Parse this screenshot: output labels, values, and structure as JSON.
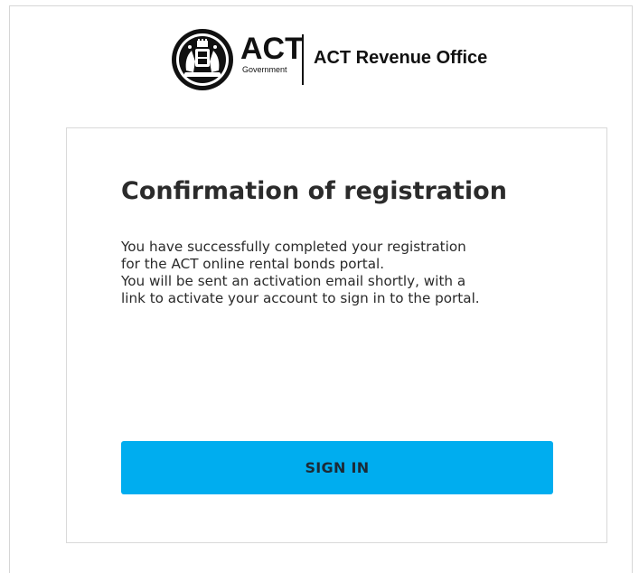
{
  "header": {
    "logo_word": "ACT",
    "logo_subword": "Government",
    "office_name": "ACT Revenue Office",
    "seal_icon": "act-coat-of-arms-seal"
  },
  "card": {
    "title": "Confirmation of registration",
    "message_lines": [
      "You have successfully completed your registration",
      "for the ACT online rental bonds portal.",
      "You will be sent an activation email shortly, with a",
      "link to activate your account to sign in to the portal."
    ],
    "signin_label": "SIGN IN"
  },
  "colors": {
    "button_bg": "#00adef",
    "button_text": "#1c2a36",
    "title_text": "#2b2b2b",
    "border": "#d9d9d9"
  }
}
